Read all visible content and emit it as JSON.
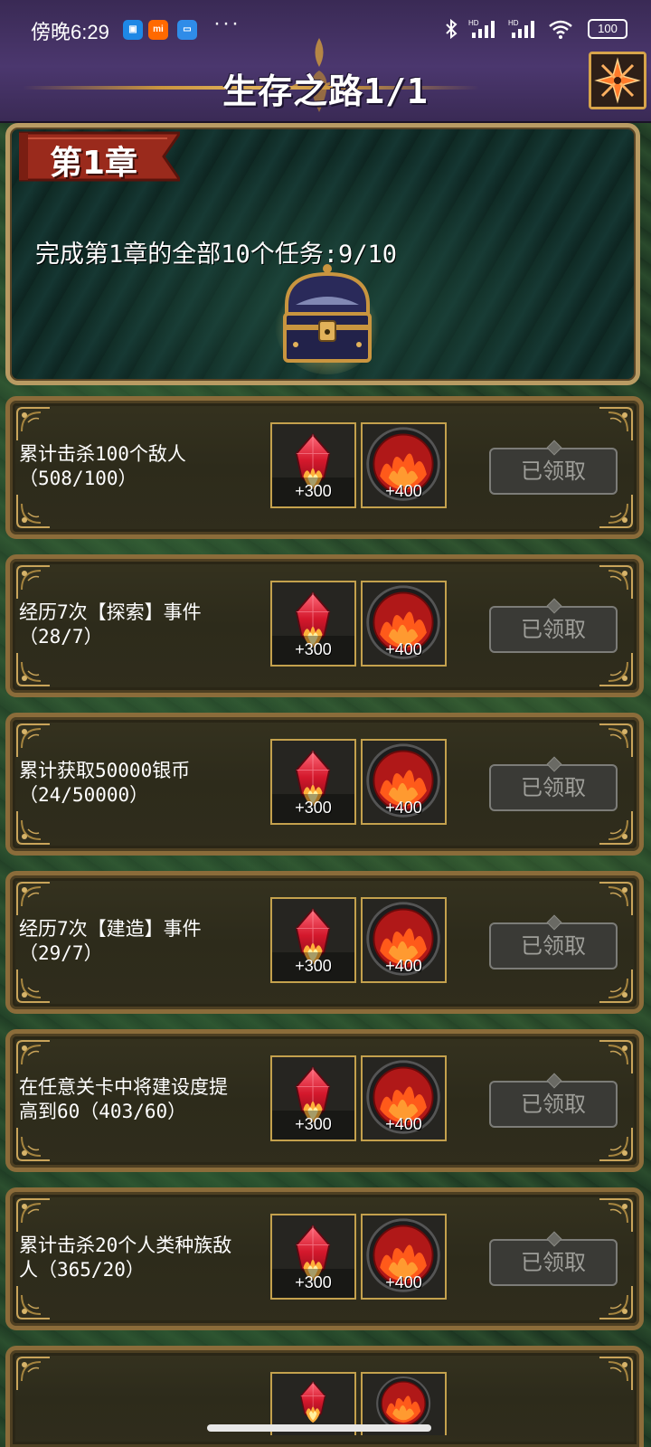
{
  "status_bar": {
    "time": "傍晚6:29",
    "battery": "100",
    "icons": [
      "bilibili-icon",
      "xiaomi-icon",
      "wallet-icon",
      "more-dots-icon",
      "bluetooth-icon",
      "signal-hd-icon",
      "signal-hd-icon",
      "wifi-icon",
      "battery-icon"
    ],
    "more": "···"
  },
  "header": {
    "title": "生存之路1/1",
    "close_icon": "compass-close-icon",
    "accent_color": "#4b376e",
    "gold_color": "#d7a44a"
  },
  "chapter": {
    "label": "第1章",
    "task": "完成第1章的全部10个任务:9/10",
    "reward_icon": "treasure-chest-icon"
  },
  "tasks": [
    {
      "text": "累计击杀100个敌人\n（508/100）",
      "rewards": [
        {
          "icon": "red-crystal-icon",
          "amount": "+300"
        },
        {
          "icon": "fire-orb-icon",
          "amount": "+400"
        }
      ],
      "button": "已领取"
    },
    {
      "text": "经历7次【探索】事件\n（28/7）",
      "rewards": [
        {
          "icon": "red-crystal-icon",
          "amount": "+300"
        },
        {
          "icon": "fire-orb-icon",
          "amount": "+400"
        }
      ],
      "button": "已领取"
    },
    {
      "text": "累计获取50000银币\n（24/50000）",
      "rewards": [
        {
          "icon": "red-crystal-icon",
          "amount": "+300"
        },
        {
          "icon": "fire-orb-icon",
          "amount": "+400"
        }
      ],
      "button": "已领取"
    },
    {
      "text": "经历7次【建造】事件\n（29/7）",
      "rewards": [
        {
          "icon": "red-crystal-icon",
          "amount": "+300"
        },
        {
          "icon": "fire-orb-icon",
          "amount": "+400"
        }
      ],
      "button": "已领取"
    },
    {
      "text": "在任意关卡中将建设度提\n高到60（403/60）",
      "rewards": [
        {
          "icon": "red-crystal-icon",
          "amount": "+300"
        },
        {
          "icon": "fire-orb-icon",
          "amount": "+400"
        }
      ],
      "button": "已领取"
    },
    {
      "text": "累计击杀20个人类种族敌\n人（365/20）",
      "rewards": [
        {
          "icon": "red-crystal-icon",
          "amount": "+300"
        },
        {
          "icon": "fire-orb-icon",
          "amount": "+400"
        }
      ],
      "button": "已领取"
    }
  ]
}
